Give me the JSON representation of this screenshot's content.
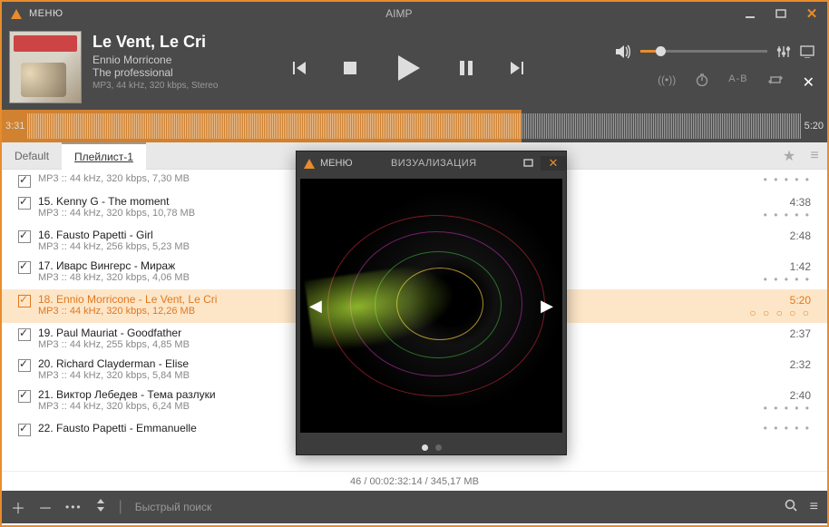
{
  "app": {
    "menu_label": "МЕНЮ",
    "title": "AIMP"
  },
  "track": {
    "title": "Le Vent, Le Cri",
    "artist": "Ennio Morricone",
    "album": "The professional",
    "format": "MP3, 44 kHz, 320 kbps, Stereo"
  },
  "times": {
    "elapsed": "3:31",
    "total": "5:20"
  },
  "util": {
    "ab": "A-B"
  },
  "tabs": {
    "default": "Default",
    "pl1": "Плейлист-1"
  },
  "playlist": [
    {
      "chk": true,
      "title": "",
      "info": "MP3 :: 44 kHz, 320 kbps, 7,30 MB",
      "dur": "",
      "dots": true,
      "partial": true
    },
    {
      "chk": true,
      "title": "15. Kenny G - The moment",
      "info": "MP3 :: 44 kHz, 320 kbps, 10,78 MB",
      "dur": "4:38",
      "dots": true
    },
    {
      "chk": true,
      "title": "16. Fausto Papetti - Girl",
      "info": "MP3 :: 44 kHz, 256 kbps, 5,23 MB",
      "dur": "2:48",
      "dots": false
    },
    {
      "chk": true,
      "title": "17. Иварс Вингерс - Мираж",
      "info": "MP3 :: 48 kHz, 320 kbps, 4,06 MB",
      "dur": "1:42",
      "dots": true
    },
    {
      "chk": true,
      "title": "18. Ennio Morricone - Le Vent, Le Cri",
      "info": "MP3 :: 44 kHz, 320 kbps, 12,26 MB",
      "dur": "5:20",
      "dots": true,
      "current": true
    },
    {
      "chk": true,
      "title": "19. Paul Mauriat - Goodfather",
      "info": "MP3 :: 44 kHz, 255 kbps, 4,85 MB",
      "dur": "2:37",
      "dots": false
    },
    {
      "chk": true,
      "title": "20. Richard Clayderman - Elise",
      "info": "MP3 :: 44 kHz, 320 kbps, 5,84 MB",
      "dur": "2:32",
      "dots": false
    },
    {
      "chk": true,
      "title": "21. Виктор Лебедев - Тема разлуки",
      "info": "MP3 :: 44 kHz, 320 kbps, 6,24 MB",
      "dur": "2:40",
      "dots": true
    },
    {
      "chk": true,
      "title": "22. Fausto Papetti - Emmanuelle",
      "info": "",
      "dur": "",
      "dots": true,
      "partial": true
    }
  ],
  "status": "46 / 00:02:32:14 / 345,17 MB",
  "footer": {
    "search_placeholder": "Быстрый поиск"
  },
  "viz": {
    "menu": "МЕНЮ",
    "title": "ВИЗУАЛИЗАЦИЯ"
  }
}
